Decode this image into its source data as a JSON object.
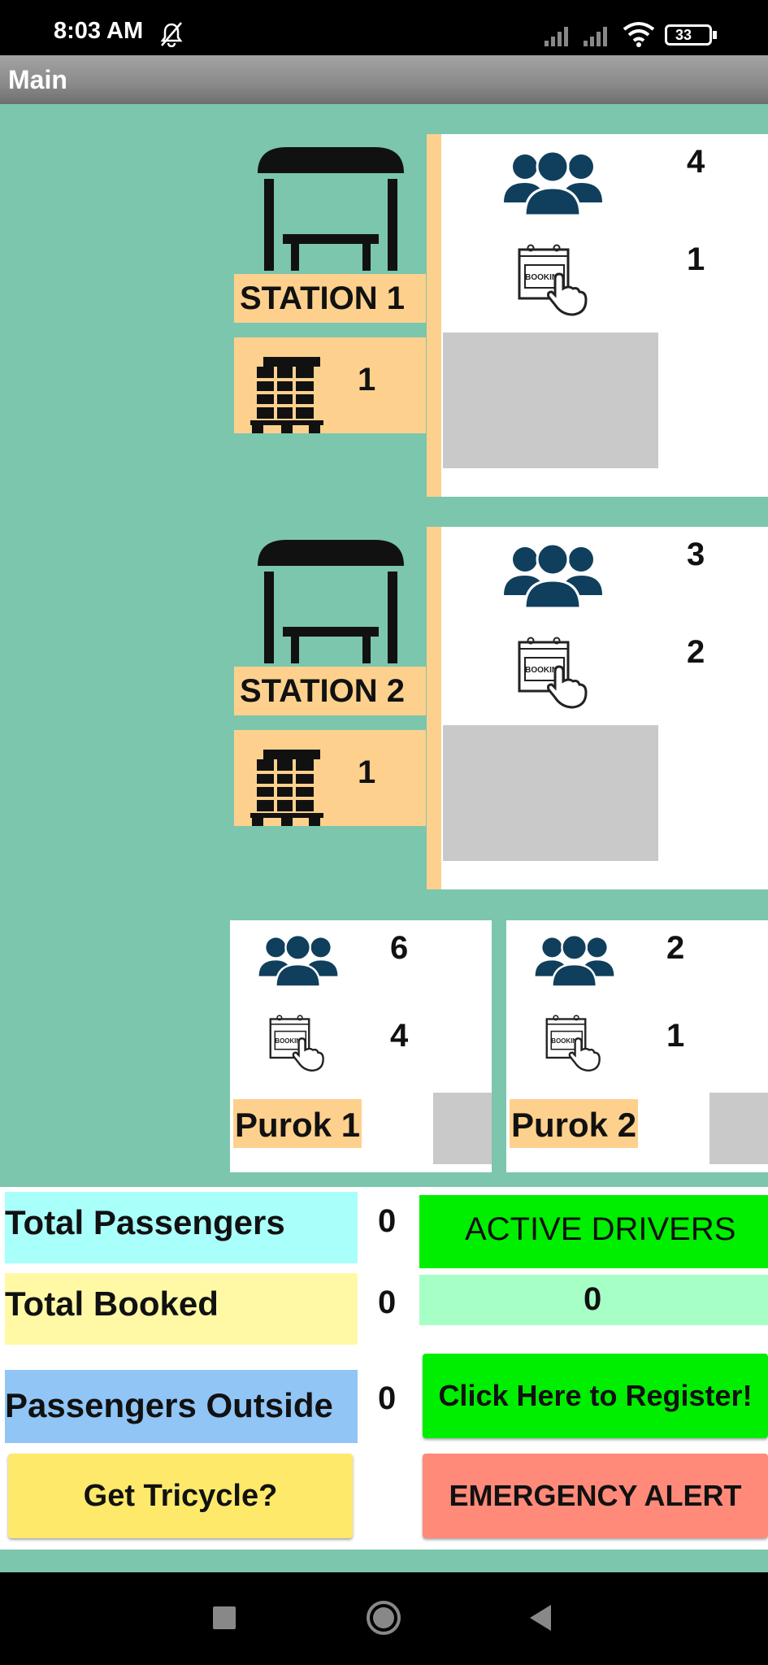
{
  "status_bar": {
    "time": "8:03 AM",
    "battery": "33"
  },
  "app": {
    "title": "Main"
  },
  "stations": [
    {
      "name": "STATION 1",
      "passengers": "4",
      "bookings": "1",
      "parcels": "1"
    },
    {
      "name": "STATION 2",
      "passengers": "3",
      "bookings": "2",
      "parcels": "1"
    }
  ],
  "puroks": [
    {
      "name": "Purok 1",
      "passengers": "6",
      "bookings": "4"
    },
    {
      "name": "Purok 2",
      "passengers": "2",
      "bookings": "1"
    }
  ],
  "summary": {
    "total_passengers_label": "Total Passengers",
    "total_passengers": "0",
    "total_booked_label": "Total Booked",
    "total_booked": "0",
    "passengers_outside_label": "Passengers Outside",
    "passengers_outside": "0",
    "active_drivers_label": "ACTIVE DRIVERS",
    "active_drivers": "0"
  },
  "buttons": {
    "register": "Click Here to Register!",
    "get_tricycle": "Get Tricycle?",
    "emergency": "EMERGENCY ALERT"
  },
  "booking_icon_text": "BOOKING",
  "colors": {
    "background": "#7bc6ad",
    "orange": "#fdd18d",
    "icon_blue": "#0f3f5c",
    "green": "#00ee00",
    "light_green": "#a6ffc4",
    "cyan": "#a9fff9",
    "yellow": "#fff9a6",
    "blue": "#91c5f6",
    "button_yellow": "#ffe96a",
    "red": "#ff8a7a"
  }
}
